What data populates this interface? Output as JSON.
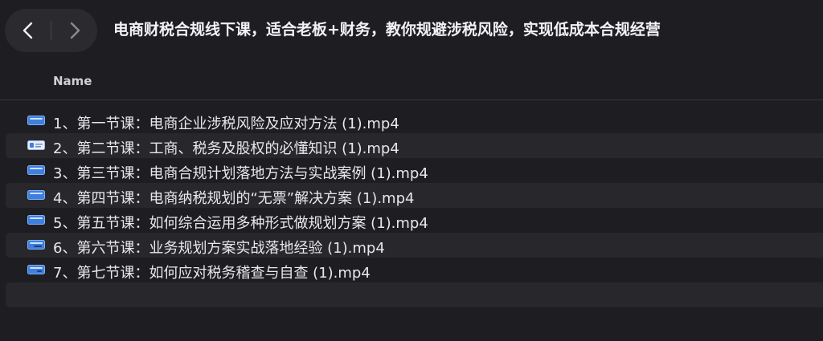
{
  "toolbar": {
    "back_icon": "chevron-left-icon",
    "forward_icon": "chevron-right-icon",
    "title": "电商财税合规线下课，适合老板+财务，教你规避涉税风险，实现低成本合规经营"
  },
  "list": {
    "column_name": "Name",
    "files": [
      {
        "name": "1、第一节课：电商企业涉税风险及应对方法 (1).mp4",
        "icon": "video-file-icon"
      },
      {
        "name": "2、第二节课：工商、税务及股权的必懂知识 (1).mp4",
        "icon": "video-file-icon"
      },
      {
        "name": "3、第三节课：电商合规计划落地方法与实战案例 (1).mp4",
        "icon": "video-file-icon"
      },
      {
        "name": "4、第四节课：电商纳税规划的“无票”解决方案 (1).mp4",
        "icon": "video-file-icon"
      },
      {
        "name": "5、第五节课：如何综合运用多种形式做规划方案 (1).mp4",
        "icon": "video-file-icon"
      },
      {
        "name": "6、第六节课：业务规划方案实战落地经验 (1).mp4",
        "icon": "video-file-icon"
      },
      {
        "name": "7、第七节课：如何应对税务稽查与自查 (1).mp4",
        "icon": "video-file-icon"
      }
    ]
  },
  "colors": {
    "background": "#1e1e22",
    "row_alt": "#27272c",
    "icon_blue": "#3f7fe0"
  }
}
